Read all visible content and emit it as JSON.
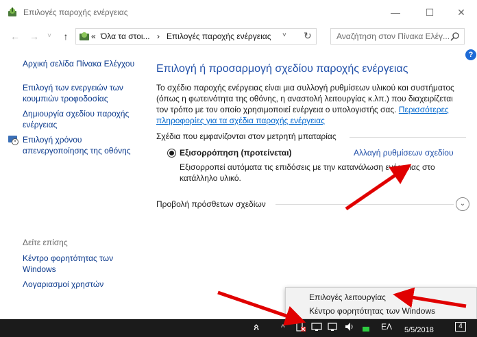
{
  "window": {
    "title": "Επιλογές παροχής ενέργειας",
    "controls": {
      "minimize": "—",
      "maximize": "☐",
      "close": "✕"
    }
  },
  "nav": {
    "back": "←",
    "forward": "→",
    "history": "˅",
    "up": "↑",
    "breadcrumb_prefix": "«",
    "breadcrumb_root": "Όλα τα στοι...",
    "breadcrumb_sep": "›",
    "breadcrumb_current": "Επιλογές παροχής ενέργειας",
    "dropdown": "˅",
    "refresh": "↻"
  },
  "search": {
    "placeholder": "Αναζήτηση στον Πίνακα Ελέγ..."
  },
  "help": "?",
  "sidebar": {
    "home": "Αρχική σελίδα Πίνακα Ελέγχου",
    "items": [
      {
        "line1": "Επιλογή των ενεργειών των",
        "line2": "κουμπιών τροφοδοσίας"
      },
      {
        "line1": "Δημιουργία σχεδίου παροχής",
        "line2": "ενέργειας"
      },
      {
        "line1": "Επιλογή χρόνου",
        "line2": "απενεργοποίησης της οθόνης"
      }
    ],
    "see_also": "Δείτε επίσης",
    "see_also_items": [
      {
        "line1": "Κέντρο φορητότητας των",
        "line2": "Windows"
      },
      {
        "line1": "Λογαριασμοί χρηστών",
        "line2": ""
      }
    ]
  },
  "main": {
    "title": "Επιλογή ή προσαρμογή σχεδίου παροχής ενέργειας",
    "description": "Το σχέδιο παροχής ενέργειας είναι μια συλλογή ρυθμίσεων υλικού και συστήματος (όπως η φωτεινότητα της οθόνης, η αναστολή λειτουργίας κ.λπ.) που διαχειρίζεται τον τρόπο με τον οποίο χρησιμοποιεί ενέργεια ο υπολογιστής σας. ",
    "more_info_link": "Περισσότερες πληροφορίες για τα σχέδια παροχής ενέργειας",
    "plans_header": "Σχέδια που εμφανίζονται στον μετρητή μπαταρίας",
    "plan": {
      "name": "Εξισορρόπηση (προτείνεται)",
      "selected": true,
      "change_link": "Αλλαγή ρυθμίσεων σχεδίου",
      "description": "Εξισορροπεί αυτόματα τις επιδόσεις με την κατανάλωση ενέργειας στο κατάλληλο υλικό."
    },
    "more_plans": "Προβολή πρόσθετων σχεδίων",
    "expand_icon": "⌄"
  },
  "context_menu": {
    "items": [
      "Επιλογές λειτουργίας",
      "Κέντρο φορητότητας των Windows"
    ]
  },
  "taskbar": {
    "language": "ΕΛ",
    "date": "5/5/2018",
    "notifications": "4",
    "people_icon": "ጰ",
    "chevron": "^"
  },
  "colors": {
    "title_link": "#1f4ea8",
    "link": "#0c3a8c",
    "annotation_arrow": "#e00000",
    "taskbar": "#1b1b1b"
  }
}
